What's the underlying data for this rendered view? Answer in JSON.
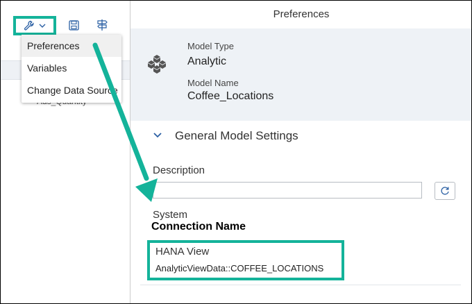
{
  "toolbar": {
    "wrench_icon": "wrench-icon",
    "dropdown_icon": "chevron-down-icon",
    "save_icon": "save-icon",
    "signpost_icon": "signpost-icon",
    "partial_label": "A"
  },
  "menu": {
    "items": [
      "Preferences",
      "Variables",
      "Change Data Source"
    ]
  },
  "left": {
    "partial_text": "Ads_Quantity"
  },
  "preferences": {
    "title": "Preferences",
    "model_type_label": "Model Type",
    "model_type_value": "Analytic",
    "model_name_label": "Model Name",
    "model_name_value": "Coffee_Locations",
    "section_title": "General Model Settings",
    "description_label": "Description",
    "description_value": "",
    "system_label": "System",
    "connection_name": "Connection Name",
    "hana_view_label": "HANA View",
    "hana_view_value": "AnalyticViewData::COFFEE_LOCATIONS"
  },
  "colors": {
    "accent_highlight": "#14b39a",
    "icon_blue": "#2a5fa3",
    "header_bg": "#eef2f6"
  }
}
